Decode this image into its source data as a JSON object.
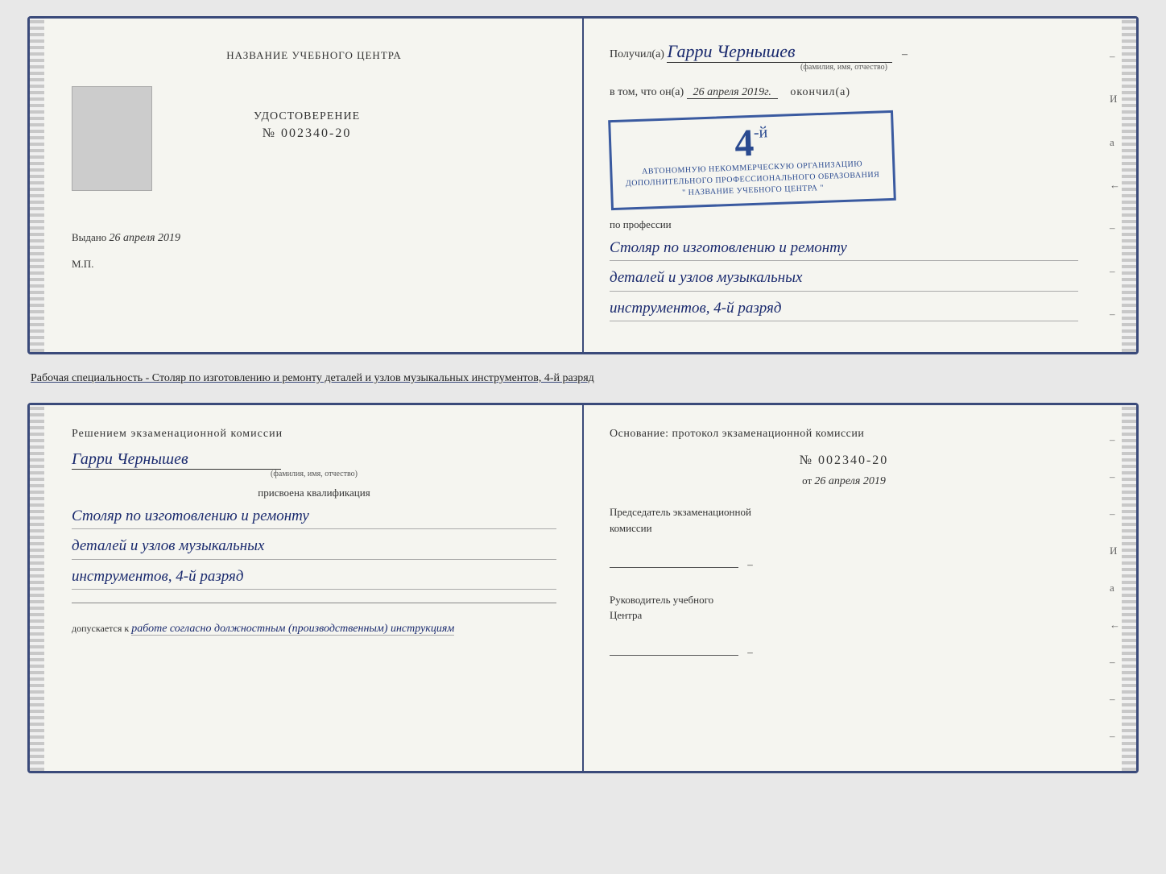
{
  "top_cert": {
    "left": {
      "title": "НАЗВАНИЕ УЧЕБНОГО ЦЕНТРА",
      "photo_alt": "фото",
      "udostoverenie": "УДОСТОВЕРЕНИЕ",
      "number_prefix": "№",
      "number": "002340-20",
      "vydano_label": "Выдано",
      "vydano_date": "26 апреля 2019",
      "mp": "М.П."
    },
    "right": {
      "poluchil": "Получил(а)",
      "name": "Гарри Чернышев",
      "name_hint": "(фамилия, имя, отчество)",
      "dash": "–",
      "vtom": "в том, что он(а)",
      "date": "26 апреля 2019г.",
      "okonchil": "окончил(а)",
      "stamp_grade": "4",
      "stamp_grade_suffix": "-й",
      "stamp_line1": "АВТОНОМНУЮ НЕКОММЕРЧЕСКУЮ ОРГАНИЗАЦИЮ",
      "stamp_line2": "ДОПОЛНИТЕЛЬНОГО ПРОФЕССИОНАЛЬНОГО ОБРАЗОВАНИЯ",
      "stamp_line3": "\" НАЗВАНИЕ УЧЕБНОГО ЦЕНТРА \"",
      "po_professii": "по профессии",
      "profession_line1": "Столяр по изготовлению и ремонту",
      "profession_line2": "деталей и узлов музыкальных",
      "profession_line3": "инструментов, 4-й разряд",
      "dashes": [
        "–",
        "И",
        "а",
        "←",
        "–",
        "–",
        "–"
      ]
    }
  },
  "subtitle": "Рабочая специальность - Столяр по изготовлению и ремонту деталей и узлов музыкальных инструментов, 4-й разряд",
  "bottom_cert": {
    "left": {
      "resheniem": "Решением экзаменационной комиссии",
      "name": "Гарри Чернышев",
      "name_hint": "(фамилия, имя, отчество)",
      "prisvoena": "присвоена квалификация",
      "qual_line1": "Столяр по изготовлению и ремонту",
      "qual_line2": "деталей и узлов музыкальных",
      "qual_line3": "инструментов, 4-й разряд",
      "dopuskaetsya_label": "допускается к",
      "dopusk_text": "работе согласно должностным (производственным) инструкциям"
    },
    "right": {
      "osnovanie": "Основание: протокол экзаменационной комиссии",
      "number_prefix": "№",
      "number": "002340-20",
      "ot_label": "от",
      "ot_date": "26 апреля 2019",
      "predsedatel_line1": "Председатель экзаменационной",
      "predsedatel_line2": "комиссии",
      "rukovoditel_line1": "Руководитель учебного",
      "rukovoditel_line2": "Центра",
      "dashes": [
        "–",
        "–",
        "–",
        "И",
        "а",
        "←",
        "–",
        "–",
        "–"
      ]
    }
  }
}
